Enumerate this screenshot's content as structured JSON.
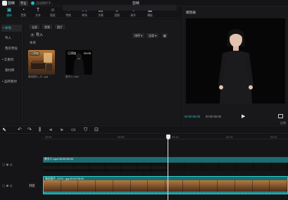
{
  "titlebar": {
    "app_name": "剪映",
    "version": "专业",
    "autosave": "自动保存于...",
    "doc_title": "剪映"
  },
  "toolbar": {
    "tools": [
      {
        "label": "媒体",
        "icon": "media-icon",
        "glyph": "▣",
        "active": true
      },
      {
        "label": "音频",
        "icon": "audio-icon",
        "glyph": "◔",
        "active": false
      },
      {
        "label": "文本",
        "icon": "text-icon",
        "glyph": "T",
        "active": false
      },
      {
        "label": "贴纸",
        "icon": "sticker-icon",
        "glyph": "☺",
        "active": false
      },
      {
        "label": "特效",
        "icon": "effects-icon",
        "glyph": "✦",
        "active": false
      },
      {
        "label": "转场",
        "icon": "transition-icon",
        "glyph": "⋈",
        "active": false
      },
      {
        "label": "字幕",
        "icon": "caption-icon",
        "glyph": "▤",
        "active": false
      },
      {
        "label": "滤镜",
        "icon": "filter-icon",
        "glyph": "◈",
        "active": false
      },
      {
        "label": "调节",
        "icon": "adjust-icon",
        "glyph": "⚟",
        "active": false
      },
      {
        "label": "模板",
        "icon": "template-icon",
        "glyph": "▦",
        "active": false
      }
    ]
  },
  "leftnav": {
    "items": [
      {
        "label": "• 本地",
        "active": true
      },
      {
        "label": "导入",
        "active": false
      },
      {
        "label": "我的预设",
        "active": false
      },
      {
        "label": "• 云素材",
        "active": false
      },
      {
        "label": "素材库",
        "active": false
      },
      {
        "label": "• 品牌素材",
        "active": false
      }
    ]
  },
  "media": {
    "chips": [
      "全部",
      "视频",
      "图片"
    ],
    "import_label": "导入",
    "sort_label": "排序",
    "filter_label": "全部",
    "folder_label": "本地",
    "items": [
      {
        "badge": "已添加",
        "duration": "00:05",
        "name": "微信图片_20...jpg"
      },
      {
        "badge": "已添加",
        "duration": "00:05",
        "name": "数字人.mp4"
      }
    ]
  },
  "player": {
    "title": "播放器",
    "timecode_current": "00:00:00:00",
    "timecode_total": "00:00:05:00",
    "ratio": "比例"
  },
  "timeline": {
    "ticks": [
      "00:00",
      "00:05",
      "00:10",
      "00:15",
      "00:20"
    ],
    "cover_label": "封面",
    "clips": [
      {
        "label": "数字人.mp4  00:00:05:00",
        "kind": "person"
      },
      {
        "label": "微信图片_2023...jpg  00:00:05:00",
        "kind": "room"
      }
    ]
  },
  "colors": {
    "accent": "#27c0cf",
    "clip_teal": "#1c6b72",
    "background": "#0f0f10"
  }
}
